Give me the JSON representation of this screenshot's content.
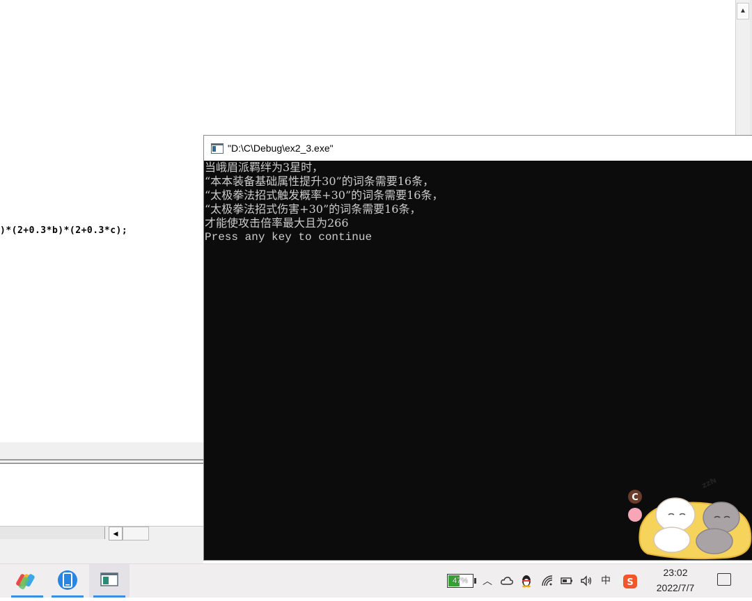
{
  "editor": {
    "code_fragment": ")*(2+0.3*b)*(2+0.3*c);"
  },
  "console": {
    "title": "\"D:\\C\\Debug\\ex2_3.exe\"",
    "lines": [
      "当峨眉派羁绊为3星时，",
      "“本本装备基础属性提升30”的词条需要16条，",
      "“太极拳法招式触发概率+30”的词条需要16条，",
      "“太极拳法招式伤害+30”的词条需要16条，",
      "才能使攻击倍率最大且为266",
      "Press any key to continue"
    ]
  },
  "taskbar": {
    "battery_percent": "47%",
    "battery_level": 0.47,
    "ime_label": "中",
    "sogou_label": "S",
    "time": "23:02",
    "date": "2022/7/7"
  },
  "sticker": {
    "badge_text": "C",
    "zzz_text": "zzN"
  },
  "colors": {
    "console_bg": "#0c0c0c",
    "console_text": "#cccccc",
    "taskbar_bg": "#f1eef0",
    "accent": "#3d8ee0"
  }
}
